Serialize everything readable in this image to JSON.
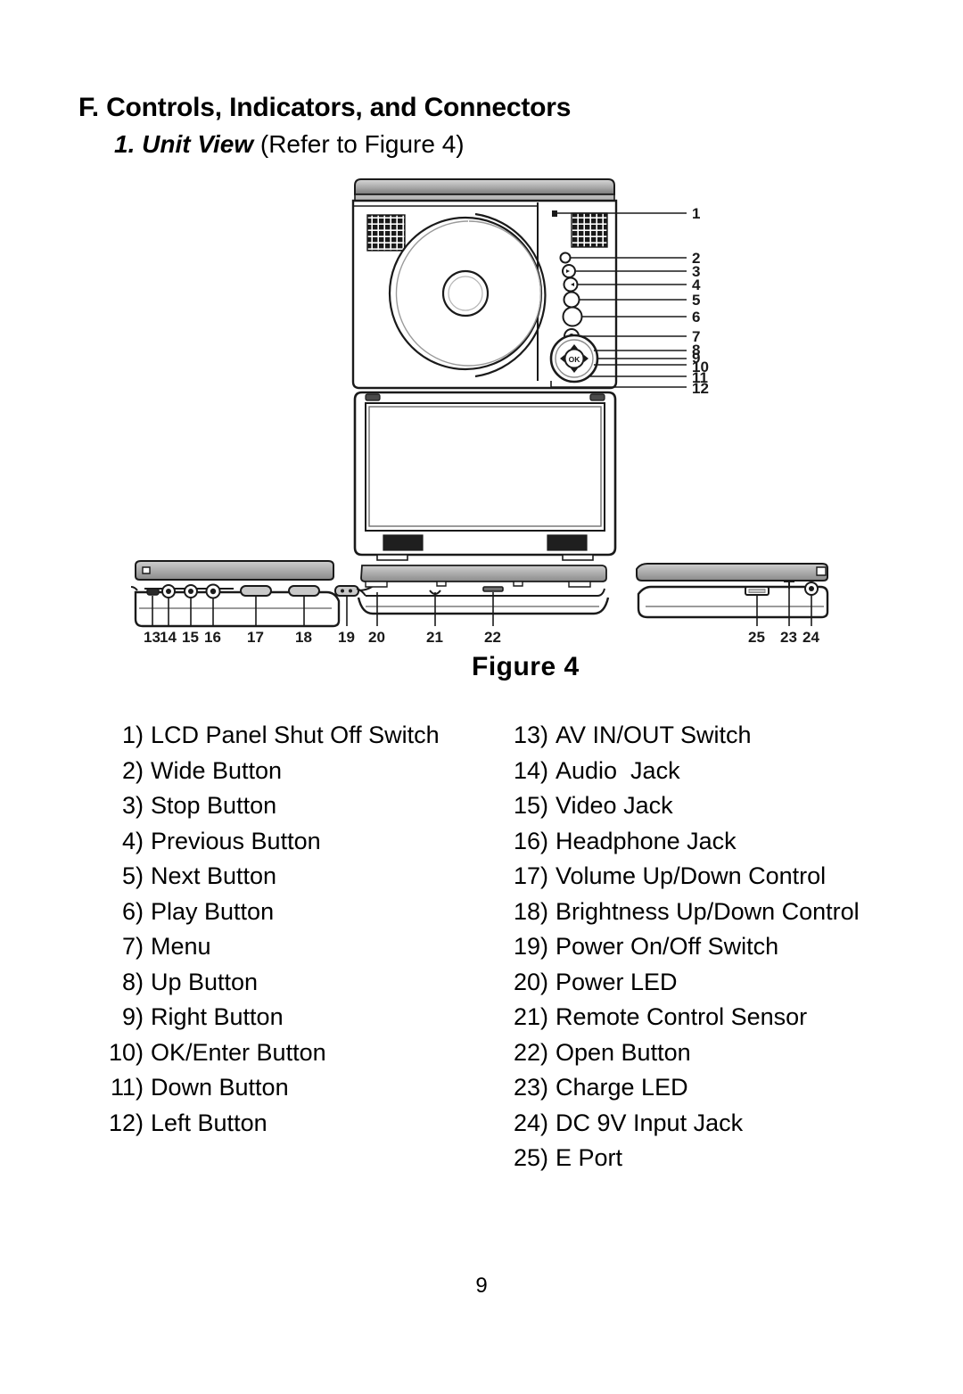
{
  "document": {
    "heading": "F. Controls, Indicators, and Connectors",
    "subheading_emphasis": "1. Unit View",
    "subheading_rest": " (Refer to Figure 4)",
    "page_number": "9"
  },
  "figure": {
    "caption": "Figure  4",
    "callouts_top_view": [
      "1",
      "2",
      "3",
      "4",
      "5",
      "6",
      "7",
      "8",
      "9",
      "10",
      "11",
      "12"
    ],
    "callouts_left_side": [
      "13",
      "14",
      "15",
      "16",
      "17",
      "18",
      "19"
    ],
    "callouts_front_side": [
      "20",
      "21",
      "22"
    ],
    "callouts_right_side": [
      "25",
      "23",
      "24"
    ],
    "dpad_center_label": "OK"
  },
  "list_left": [
    {
      "num": "1)",
      "label": "LCD Panel Shut Off Switch"
    },
    {
      "num": "2)",
      "label": "Wide Button"
    },
    {
      "num": "3)",
      "label": "Stop Button"
    },
    {
      "num": "4)",
      "label": "Previous Button"
    },
    {
      "num": "5)",
      "label": "Next Button"
    },
    {
      "num": "6)",
      "label": "Play Button"
    },
    {
      "num": "7)",
      "label": "Menu"
    },
    {
      "num": "8)",
      "label": "Up Button"
    },
    {
      "num": "9)",
      "label": "Right Button"
    },
    {
      "num": "10)",
      "label": "OK/Enter Button"
    },
    {
      "num": "11)",
      "label": "Down Button"
    },
    {
      "num": "12)",
      "label": "Left Button"
    }
  ],
  "list_right": [
    {
      "num": "13)",
      "label": "AV IN/OUT Switch"
    },
    {
      "num": "14)",
      "label": "Audio  Jack"
    },
    {
      "num": "15)",
      "label": "Video Jack"
    },
    {
      "num": "16)",
      "label": "Headphone Jack"
    },
    {
      "num": "17)",
      "label": "Volume Up/Down Control"
    },
    {
      "num": "18)",
      "label": "Brightness Up/Down Control"
    },
    {
      "num": "19)",
      "label": "Power On/Off Switch"
    },
    {
      "num": "20)",
      "label": "Power LED"
    },
    {
      "num": "21)",
      "label": "Remote Control Sensor"
    },
    {
      "num": "22)",
      "label": "Open Button"
    },
    {
      "num": "23)",
      "label": "Charge LED"
    },
    {
      "num": "24)",
      "label": "DC 9V Input Jack"
    },
    {
      "num": "25)",
      "label": "E Port"
    }
  ]
}
